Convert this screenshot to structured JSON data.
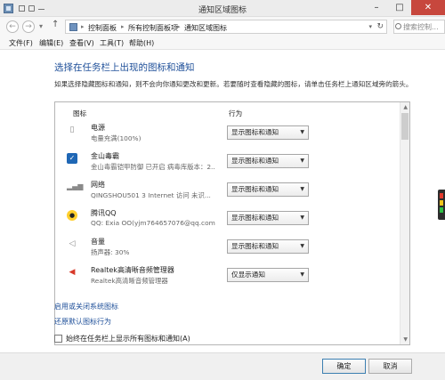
{
  "window": {
    "title": "通知区域图标"
  },
  "navbar": {
    "back_glyph": "←",
    "forward_glyph": "→",
    "recent_glyph": "▾",
    "up_glyph": "↑",
    "breadcrumbs": [
      "控制面板",
      "所有控制面板项",
      "通知区域图标"
    ],
    "separator": "▸",
    "search_placeholder": "搜索控制..."
  },
  "menu": {
    "items": [
      "文件(F)",
      "编辑(E)",
      "查看(V)",
      "工具(T)",
      "帮助(H)"
    ]
  },
  "main": {
    "heading": "选择在任务栏上出现的图标和通知",
    "description": "如果选择隐藏图标和通知，则不会向你通知更改和更新。若要随时查看隐藏的图标，请单击任务栏上通知区域旁的箭头。",
    "columns": {
      "icon": "图标",
      "behavior": "行为"
    },
    "rows": [
      {
        "name": "电源",
        "sub": "电量充满(100%)",
        "behavior": "显示图标和通知",
        "icon": "battery-icon"
      },
      {
        "name": "金山毒霸",
        "sub": "金山毒霸铠甲防御 已开启 病毒库版本：2...",
        "behavior": "显示图标和通知",
        "icon": "kingsoft-antivirus-icon"
      },
      {
        "name": "网络",
        "sub": "QINGSHOU501  3 Internet 访问  未识...",
        "behavior": "显示图标和通知",
        "icon": "network-signal-icon"
      },
      {
        "name": "腾讯QQ",
        "sub": "QQ: Exia OO(yjm764657076@qq.com)...",
        "behavior": "显示图标和通知",
        "icon": "qq-penguin-icon"
      },
      {
        "name": "音量",
        "sub": "扬声器: 30%",
        "behavior": "显示图标和通知",
        "icon": "speaker-volume-icon"
      },
      {
        "name": "Realtek高清晰音频管理器",
        "sub": "Realtek高清晰音频管理器",
        "behavior": "仅显示通知",
        "icon": "realtek-audio-icon"
      }
    ],
    "links": {
      "system_icons": "启用或关闭系统图标",
      "restore_defaults": "还原默认图标行为"
    },
    "always_show_label": "始终在任务栏上显示所有图标和通知(A)"
  },
  "footer": {
    "ok_label": "确定",
    "cancel_label": "取消"
  },
  "colors": {
    "link_blue": "#1e4f99",
    "close_red": "#c7473d"
  }
}
